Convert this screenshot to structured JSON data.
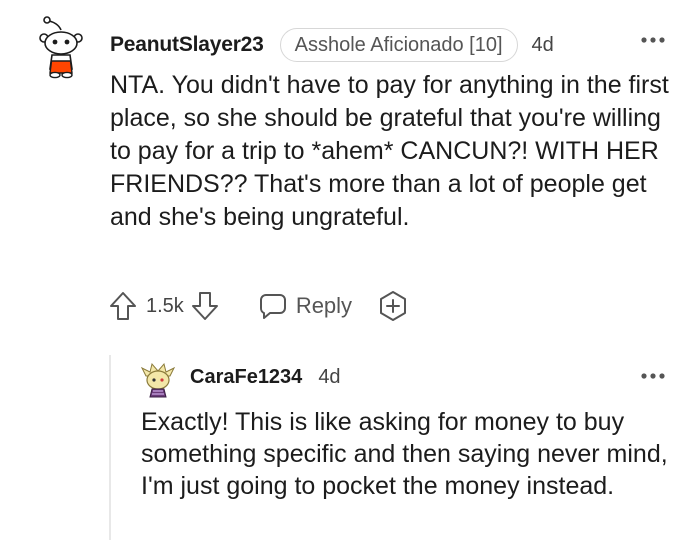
{
  "comment": {
    "username": "PeanutSlayer23",
    "flair": "Asshole Aficionado [10]",
    "timestamp": "4d",
    "body": "NTA. You didn't have to pay for anything in the first place, so she should be grateful that you're willing to pay for a trip to *ahem* CANCUN?! WITH HER FRIENDS?? That's more than a lot of people get and she's being ungrateful.",
    "vote_count": "1.5k",
    "reply_label": "Reply",
    "icons": {
      "avatar": "snoo-avatar-icon",
      "more": "more-options-icon",
      "upvote": "upvote-arrow-icon",
      "downvote": "downvote-arrow-icon",
      "reply": "chat-bubble-icon",
      "award": "award-plus-icon"
    }
  },
  "reply": {
    "username": "CaraFe1234",
    "timestamp": "4d",
    "body": "Exactly! This is like asking for money to buy something specific and then saying never mind, I'm just going to pocket the money instead.",
    "icons": {
      "avatar": "custom-avatar-icon",
      "more": "more-options-icon"
    }
  },
  "colors": {
    "text": "#1c1c1c",
    "meta": "#444444",
    "flair_border": "#d7d7d7",
    "snoo_shirt": "#ff4500"
  }
}
